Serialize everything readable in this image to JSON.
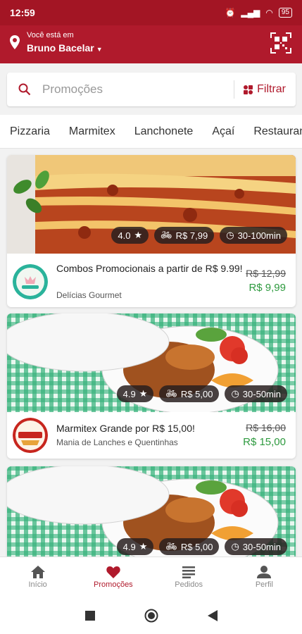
{
  "status": {
    "time": "12:59",
    "battery": "95"
  },
  "header": {
    "location_label": "Você está em",
    "location_value": "Bruno Bacelar"
  },
  "search": {
    "placeholder": "Promoções",
    "filter_label": "Filtrar"
  },
  "categories": [
    "Pizzaria",
    "Marmitex",
    "Lanchonete",
    "Açaí",
    "Restaurante"
  ],
  "offers": [
    {
      "title": "Combos Promocionais a partir de R$ 9.99!",
      "store": "Delícias Gourmet",
      "old_price": "R$ 12,99",
      "new_price": "R$ 9,99",
      "rating": "4.0",
      "delivery_fee": "R$ 7,99",
      "delivery_time": "30-100min"
    },
    {
      "title": "Marmitex Grande por R$ 15,00!",
      "store": "Mania de Lanches e Quentinhas",
      "old_price": "R$ 16,00",
      "new_price": "R$ 15,00",
      "rating": "4.9",
      "delivery_fee": "R$ 5,00",
      "delivery_time": "30-50min"
    },
    {
      "rating": "4.9",
      "delivery_fee": "R$ 5,00",
      "delivery_time": "30-50min"
    }
  ],
  "nav": [
    "Início",
    "Promoções",
    "Pedidos",
    "Perfil"
  ],
  "colors": {
    "brand": "#b01a2c",
    "price_green": "#2e9a3f"
  }
}
